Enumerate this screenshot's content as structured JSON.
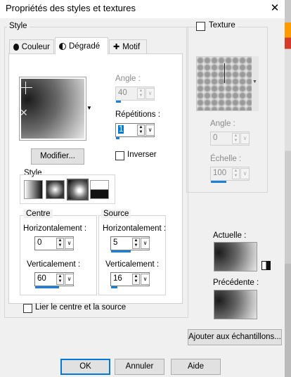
{
  "window": {
    "title": "Propriétés des styles et textures",
    "close_glyph": "✕"
  },
  "style_group": {
    "label": "Style",
    "tabs": [
      {
        "label": "Couleur",
        "icon": "color-dot-icon"
      },
      {
        "label": "Dégradé",
        "icon": "gradient-half-circle-icon"
      },
      {
        "label": "Motif",
        "icon": "pattern-icon"
      }
    ],
    "active_tab": "Dégradé"
  },
  "gradient": {
    "angle_label": "Angle :",
    "angle_value": "40",
    "repetitions_label": "Répétitions :",
    "repetitions_value": "1",
    "invert_label": "Inverser",
    "invert_checked": false,
    "edit_button": "Modifier...",
    "style_label": "Style",
    "styles": [
      "linear",
      "rectangular",
      "sunburst",
      "radial"
    ],
    "selected_style": "sunburst"
  },
  "centre": {
    "label": "Centre",
    "horizontal_label": "Horizontalement :",
    "horizontal_value": "0",
    "vertical_label": "Verticalement :",
    "vertical_value": "60"
  },
  "source": {
    "label": "Source",
    "horizontal_label": "Horizontalement :",
    "horizontal_value": "5",
    "vertical_label": "Verticalement :",
    "vertical_value": "16"
  },
  "link_label": "Lier le centre et la source",
  "texture": {
    "label": "Texture",
    "checked": false,
    "angle_label": "Angle :",
    "angle_value": "0",
    "scale_label": "Échelle :",
    "scale_value": "100"
  },
  "current_label": "Actuelle :",
  "previous_label": "Précédente :",
  "add_swatch_button": "Ajouter aux échantillons...",
  "buttons": {
    "ok": "OK",
    "cancel": "Annuler",
    "help": "Aide"
  },
  "colors": {
    "accent": "#0078d7",
    "bar": "#1e7fd8"
  }
}
